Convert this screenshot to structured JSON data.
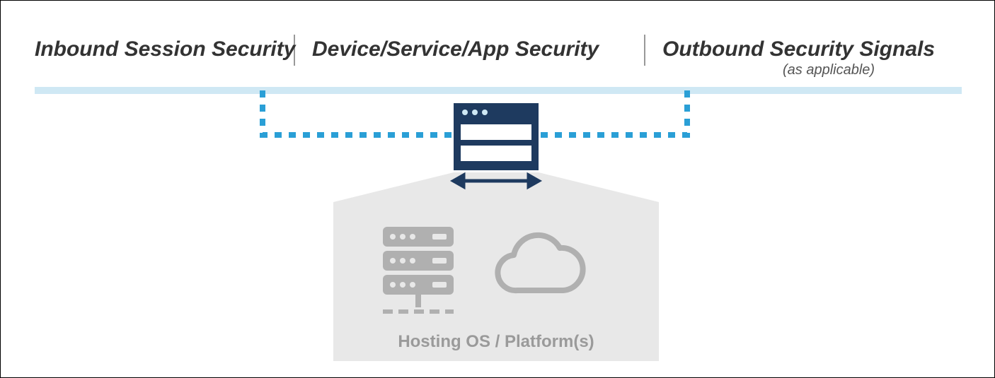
{
  "diagram": {
    "headers": {
      "left": "Inbound Session Security",
      "center": "Device/Service/App Security",
      "right": "Outbound Security Signals",
      "right_sub": "(as applicable)"
    },
    "box_label": "Hosting OS / Platform(s)",
    "colors": {
      "dark_navy": "#1e3a5f",
      "light_blue": "#cfe8f4",
      "dotted_blue": "#2a9fd6",
      "grey_box": "#e8e8e8",
      "icon_grey": "#b0b0b0",
      "divider": "#999"
    }
  }
}
